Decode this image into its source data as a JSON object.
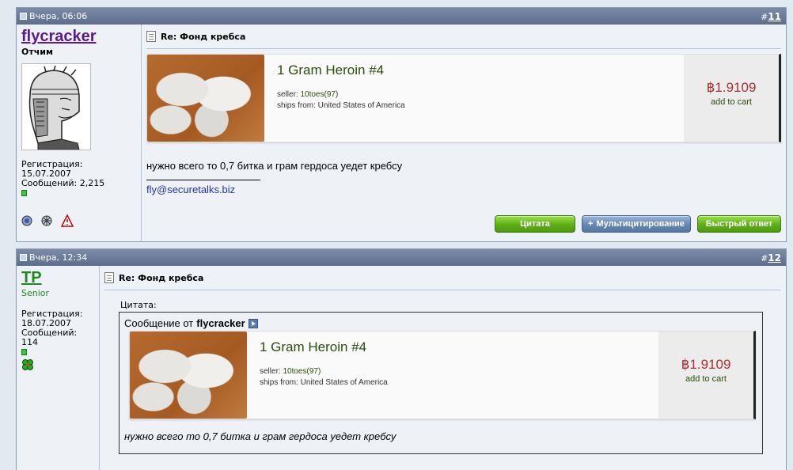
{
  "posts": [
    {
      "date": "Вчера, 06:06",
      "number_prefix": "#",
      "number": "11",
      "user": {
        "name": "flycracker",
        "title": "Отчим",
        "reg_label": "Регистрация:",
        "reg_date": "15.07.2007",
        "messages_label": "Сообщений: 2,215"
      },
      "title": "Re: Фонд кребса",
      "product": {
        "name": "1 Gram Heroin #4",
        "seller_label": "seller:",
        "seller": "10toes(97)",
        "ships_from": "ships from: United States of America",
        "price": "฿1.9109",
        "add_to_cart": "add to cart"
      },
      "message": "нужно всего то 0,7 битка и грам гердоса уедет кребсу",
      "signature": "fly@securetalks.biz",
      "buttons": {
        "quote": "Цитата",
        "multiquote": "Мультицитирование",
        "quick_reply": "Быстрый ответ"
      }
    },
    {
      "date": "Вчера, 12:34",
      "number_prefix": "#",
      "number": "12",
      "user": {
        "name": "TP",
        "title": "Senior",
        "reg_label": "Регистрация:",
        "reg_date": "18.07.2007",
        "messages_label": "Сообщений:",
        "messages_count": "114"
      },
      "title": "Re: Фонд кребса",
      "quote": {
        "label": "Цитата:",
        "from_prefix": "Сообщение от",
        "from_user": "flycracker",
        "product": {
          "name": "1 Gram Heroin #4",
          "seller_label": "seller:",
          "seller": "10toes(97)",
          "ships_from": "ships from: United States of America",
          "price": "฿1.9109",
          "add_to_cart": "add to cart"
        },
        "text": "нужно всего то 0,7 битка и грам гердоса уедет кребсу"
      }
    }
  ],
  "colors": {
    "username_1": "#5a1c8c",
    "username_2": "#1e8a1e",
    "header_bg": "#6a7a98",
    "button_green": "#5fae18",
    "button_blue": "#6587b3"
  }
}
